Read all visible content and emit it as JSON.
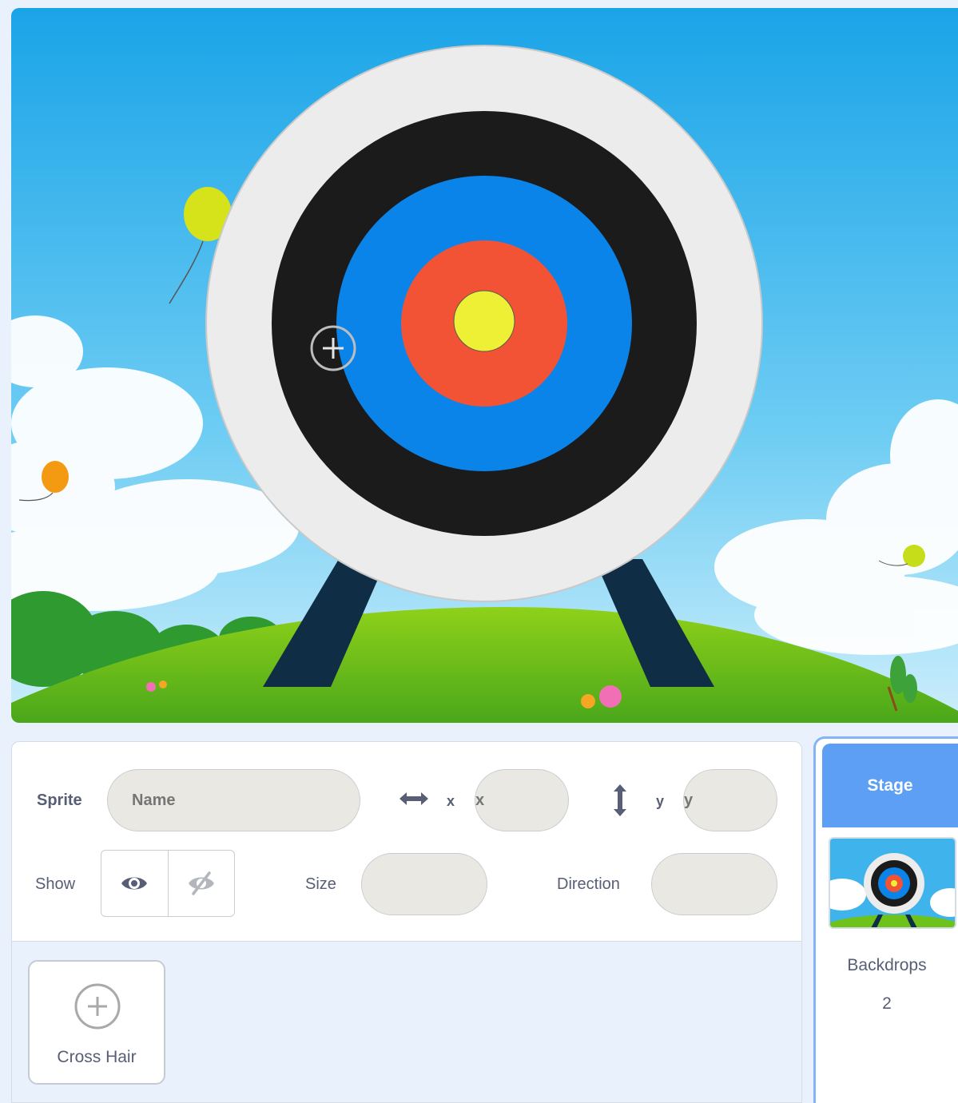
{
  "stage": {
    "sprite": "target",
    "backdrop": "blue-sky-with-clouds-and-balloons",
    "cursor": "crosshair-icon"
  },
  "sprite_info": {
    "sprite_label": "Sprite",
    "name_placeholder": "Name",
    "x_label": "x",
    "x_placeholder": "x",
    "y_label": "y",
    "y_placeholder": "y",
    "show_label": "Show",
    "size_label": "Size",
    "direction_label": "Direction"
  },
  "sprite_list": {
    "items": [
      {
        "name": "Cross Hair",
        "icon": "crosshair-icon"
      }
    ]
  },
  "stage_pane": {
    "title": "Stage",
    "backdrops_label": "Backdrops",
    "backdrops_count": "2"
  },
  "colors": {
    "accent": "#5c9ff5",
    "panel_bg": "#e9f1fc",
    "text": "#575e75"
  }
}
